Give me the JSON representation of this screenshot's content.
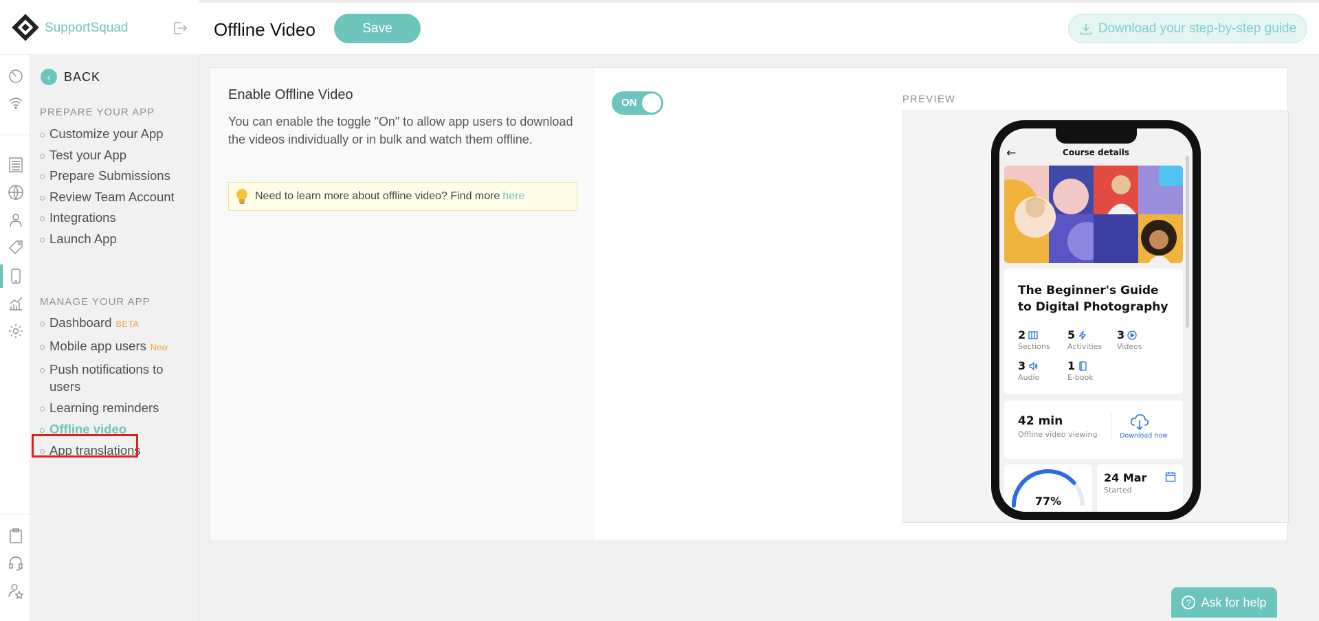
{
  "brand": {
    "name": "SupportSquad"
  },
  "rail_icons": [
    "speedometer-icon",
    "wifi-icon",
    "list-icon",
    "globe-icon",
    "user-icon",
    "tag-icon",
    "mobile-icon",
    "chart-icon",
    "gear-icon",
    "clipboard-icon",
    "headset-icon",
    "user-star-icon"
  ],
  "subnav": {
    "back_label": "BACK",
    "prepare_heading": "PREPARE YOUR APP",
    "prepare_items": [
      "Customize your App",
      "Test your App",
      "Prepare Submissions",
      "Review Team Account",
      "Integrations",
      "Launch App"
    ],
    "manage_heading": "MANAGE YOUR APP",
    "manage_items": [
      {
        "label": "Dashboard",
        "badge": "BETA"
      },
      {
        "label": "Mobile app users",
        "badge": "New"
      },
      {
        "label": "Push notifications to users"
      },
      {
        "label": "Learning reminders"
      },
      {
        "label": "Offline video",
        "active": true
      },
      {
        "label": "App translations"
      }
    ]
  },
  "header": {
    "title": "Offline Video",
    "save_label": "Save",
    "download_label": "Download your step-by-step guide"
  },
  "content": {
    "heading": "Enable Offline Video",
    "description": "You can enable the toggle \"On\" to allow app users to download the videos individually or in bulk and watch them offline.",
    "tip_text": "Need to learn more about offline video? Find more",
    "tip_link": "here",
    "toggle_label": "ON",
    "toggle_on": true,
    "preview_label": "PREVIEW"
  },
  "phone": {
    "header_title": "Course details",
    "course_title": "The Beginner's Guide to Digital Photography",
    "stats": [
      {
        "n": "2",
        "l": "Sections",
        "icon": "columns-icon"
      },
      {
        "n": "5",
        "l": "Activities",
        "icon": "bolt-icon"
      },
      {
        "n": "3",
        "l": "Videos",
        "icon": "play-icon"
      },
      {
        "n": "3",
        "l": "Audio",
        "icon": "speaker-icon"
      },
      {
        "n": "1",
        "l": "E-book",
        "icon": "book-icon"
      }
    ],
    "duration": "42 min",
    "duration_label": "Offline video viewing",
    "download_now": "Download now",
    "progress": "77%",
    "progress_value": 0.77,
    "date": "24 Mar",
    "date_label": "Started"
  },
  "help": {
    "label": "Ask for help"
  },
  "colors": {
    "accent": "#6cc5bd",
    "highlight": "#e0201b",
    "phone_blue": "#2d6cdf"
  }
}
